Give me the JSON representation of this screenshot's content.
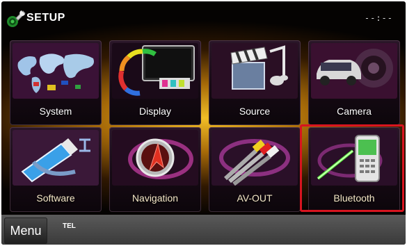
{
  "header": {
    "title": "SETUP",
    "clock": "--:--",
    "icon": "wrench-icon"
  },
  "tiles": [
    {
      "label": "System",
      "icon": "world-map-icon"
    },
    {
      "label": "Display",
      "icon": "display-icon"
    },
    {
      "label": "Source",
      "icon": "source-clapper-music-icon"
    },
    {
      "label": "Camera",
      "icon": "rear-camera-car-icon"
    },
    {
      "label": "Software",
      "icon": "usb-stick-icon"
    },
    {
      "label": "Navigation",
      "icon": "navigation-arrow-icon"
    },
    {
      "label": "AV-OUT",
      "icon": "av-cables-icon"
    },
    {
      "label": "Bluetooth",
      "icon": "bluetooth-phone-icon"
    }
  ],
  "highlighted_tile": "Bluetooth",
  "highlight_color": "#d8141f",
  "bottom_bar": {
    "menu_label": "Menu",
    "tel_label": "TEL"
  }
}
